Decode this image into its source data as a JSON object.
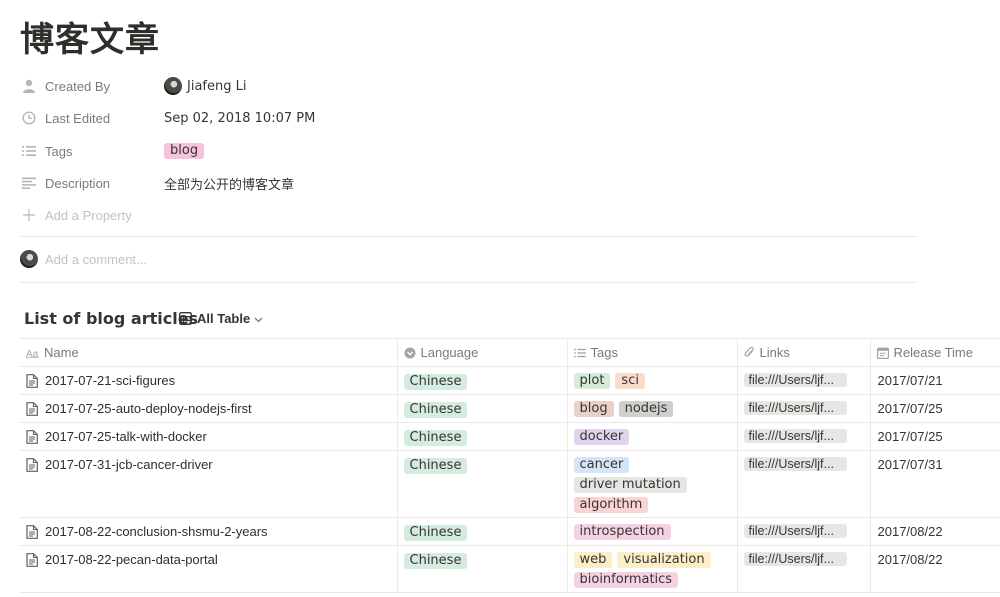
{
  "page": {
    "title": "博客文章"
  },
  "properties": [
    {
      "key": "created_by",
      "icon": "person-icon",
      "label": "Created By",
      "type": "person",
      "value": "Jiafeng Li"
    },
    {
      "key": "last_edited",
      "icon": "clock-icon",
      "label": "Last Edited",
      "type": "text",
      "value": "Sep 02, 2018 10:07 PM"
    },
    {
      "key": "tags",
      "icon": "list-icon",
      "label": "Tags",
      "type": "tag",
      "value": "blog",
      "color": "#f5c4dc"
    },
    {
      "key": "description",
      "icon": "text-lines-icon",
      "label": "Description",
      "type": "text",
      "value": "全部为公开的博客文章"
    }
  ],
  "add_property_label": "Add a Property",
  "comment": {
    "placeholder": "Add a comment..."
  },
  "table": {
    "title": "List of blog articles",
    "view_label": "All Table",
    "columns": [
      {
        "label": "Name",
        "icon": "text-aa-icon"
      },
      {
        "label": "Language",
        "icon": "select-icon"
      },
      {
        "label": "Tags",
        "icon": "list-icon"
      },
      {
        "label": "Links",
        "icon": "paperclip-icon"
      },
      {
        "label": "Release Time",
        "icon": "calendar-icon"
      }
    ],
    "rows": [
      {
        "name": "2017-07-21-sci-figures",
        "language": "Chinese",
        "tags": [
          {
            "label": "plot",
            "color": "#d4ecd9"
          },
          {
            "label": "sci",
            "color": "#f9dccb"
          }
        ],
        "link": "file:///Users/ljf...",
        "date": "2017/07/21"
      },
      {
        "name": "2017-07-25-auto-deploy-nodejs-first",
        "language": "Chinese",
        "tags": [
          {
            "label": "blog",
            "color": "#e8d2c6"
          },
          {
            "label": "nodejs",
            "color": "#cfcfcd"
          }
        ],
        "link": "file:///Users/ljf...",
        "date": "2017/07/25"
      },
      {
        "name": "2017-07-25-talk-with-docker",
        "language": "Chinese",
        "tags": [
          {
            "label": "docker",
            "color": "#e1d3f1"
          }
        ],
        "link": "file:///Users/ljf...",
        "date": "2017/07/25"
      },
      {
        "name": "2017-07-31-jcb-cancer-driver",
        "language": "Chinese",
        "tags": [
          {
            "label": "cancer",
            "color": "#d3e5f7"
          },
          {
            "label": "driver mutation",
            "color": "#e7e6e4"
          },
          {
            "label": "algorithm",
            "color": "#f9d3d5"
          }
        ],
        "link": "file:///Users/ljf...",
        "date": "2017/07/31"
      },
      {
        "name": "2017-08-22-conclusion-shsmu-2-years",
        "language": "Chinese",
        "tags": [
          {
            "label": "introspection",
            "color": "#f6d1e4"
          }
        ],
        "link": "file:///Users/ljf...",
        "date": "2017/08/22"
      },
      {
        "name": "2017-08-22-pecan-data-portal",
        "language": "Chinese",
        "tags": [
          {
            "label": "web",
            "color": "#fbeec9"
          },
          {
            "label": "visualization",
            "color": "#fbeec9"
          },
          {
            "label": "bioinformatics",
            "color": "#f6d1e4"
          }
        ],
        "link": "file:///Users/ljf...",
        "date": "2017/08/22"
      }
    ]
  },
  "colors": {
    "language_tag": "#d3ecdf",
    "link_pill": "#e7e6e4",
    "muted_text": "#7b7a76"
  }
}
